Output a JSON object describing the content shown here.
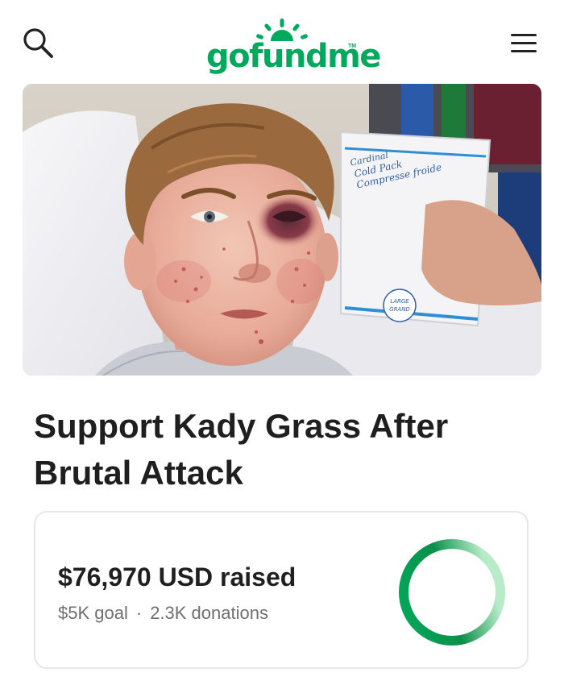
{
  "header": {
    "logo_text": "gofundme",
    "logo_tm": "TM",
    "brand_color": "#02a95c",
    "search_icon": "search-icon",
    "menu_icon": "hamburger-menu-icon"
  },
  "hero": {
    "icon": "campaign-photo",
    "cold_pack_text": "Cold Pack Compresse froide",
    "cold_pack_size": "LARGE GRAND"
  },
  "campaign": {
    "title": "Support Kady Grass After Brutal Attack"
  },
  "progress": {
    "raised": "$76,970 USD raised",
    "goal": "$5K goal",
    "separator": "·",
    "donations": "2.3K donations",
    "percent_of_goal": 1.0,
    "ring_colors": [
      "#02a95c",
      "#0c8f4a",
      "#b8ecc8"
    ]
  }
}
